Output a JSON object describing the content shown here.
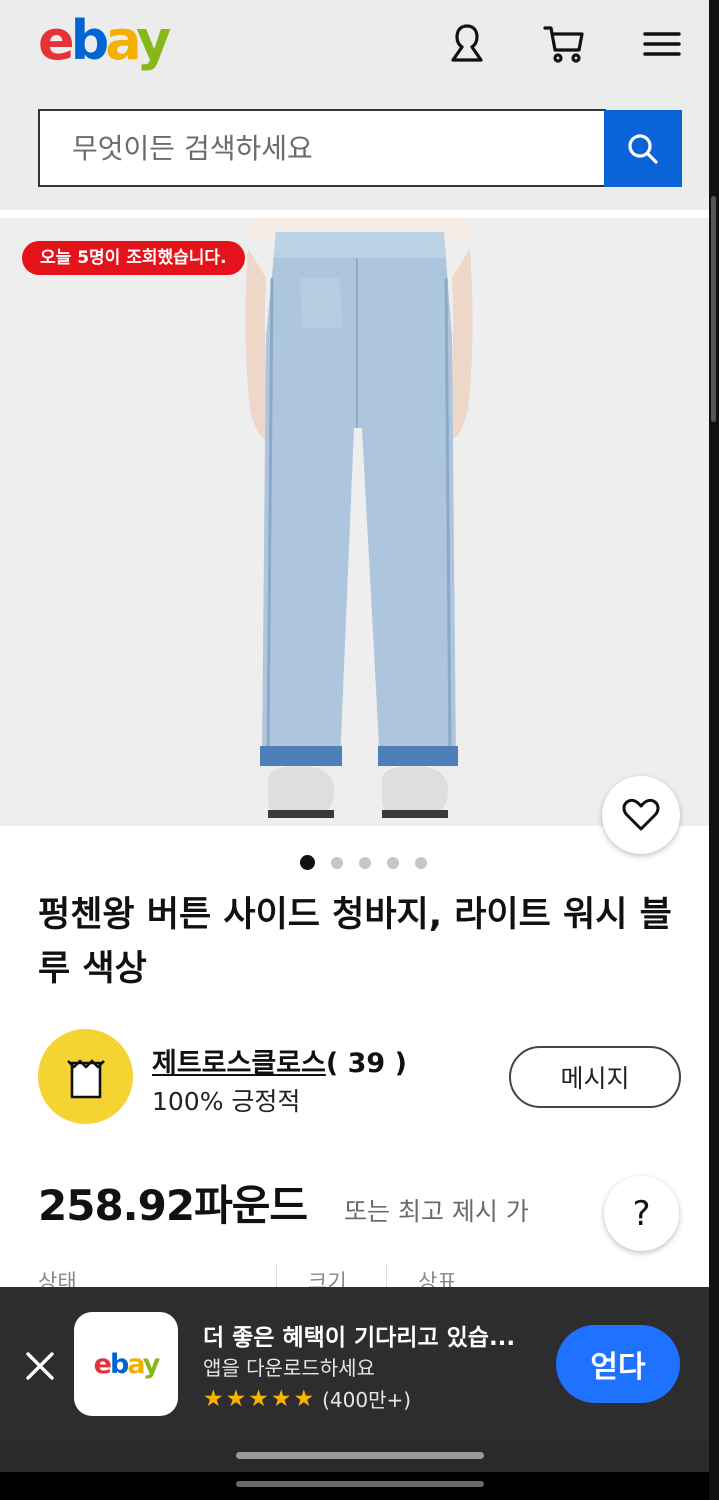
{
  "header": {
    "logo": {
      "e": "e",
      "b": "b",
      "a": "a",
      "y": "y"
    },
    "icons": [
      "account-icon",
      "cart-icon",
      "menu-icon"
    ]
  },
  "search": {
    "placeholder": "무엇이든 검색하세요",
    "button_icon": "search-icon"
  },
  "product": {
    "view_badge": "오늘 5명이 조회했습니다.",
    "image_count": 5,
    "active_image_index": 0,
    "title": "펑첸왕 버튼 사이드 청바지, 라이트 워시 블루 색상",
    "price": "258.92파운드",
    "price_note": "또는 최고 제시 가"
  },
  "seller": {
    "name": "제트로스클로스",
    "feedback_count": "( 39 )",
    "positive": "100% 긍정적",
    "message_button": "메시지"
  },
  "specs": {
    "labels": [
      "상태",
      "크기",
      "상표"
    ]
  },
  "help_button": "?",
  "app_banner": {
    "title": "더 좋은 혜택이 기다리고 있습...",
    "subtitle": "앱을 다운로드하세요",
    "rating": 5,
    "reviews": "(400만+)",
    "cta": "얻다",
    "icon_logo": {
      "e": "e",
      "b": "b",
      "a": "a",
      "y": "y"
    }
  },
  "colors": {
    "brand_blue": "#0a64d8",
    "badge_red": "#e4131b",
    "cta_blue": "#1f72ff",
    "banner_bg": "#2d2d2f",
    "star": "#f7b500"
  }
}
